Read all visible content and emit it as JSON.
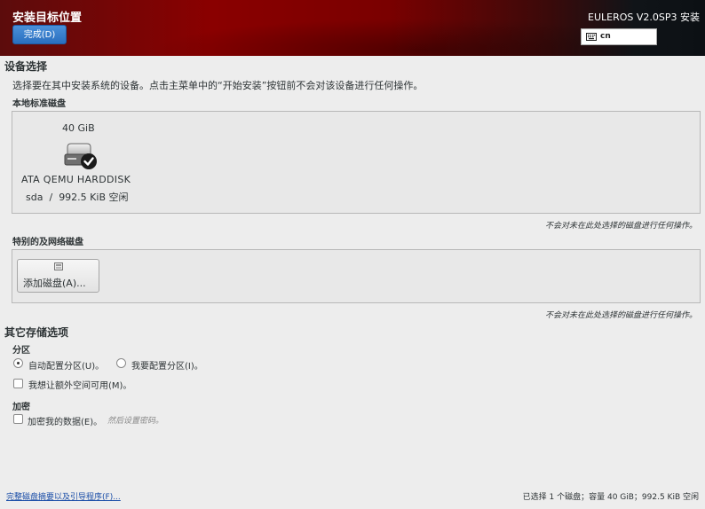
{
  "header": {
    "title": "安装目标位置",
    "done_button": "完成(D)",
    "product": "EULEROS V2.0SP3 安装",
    "keyboard_layout": "cn",
    "keyboard_icon": "keyboard-icon"
  },
  "device_selection": {
    "title": "设备选择",
    "description": "选择要在其中安装系统的设备。点击主菜单中的“开始安装”按钮前不会对该设备进行任何操作。",
    "local_disks": {
      "title": "本地标准磁盘",
      "disks": [
        {
          "size": "40 GiB",
          "name": "ATA QEMU HARDDISK",
          "device": "sda",
          "separator": "/",
          "free": "992.5 KiB 空闲",
          "selected": true,
          "icon": "harddisk-selected-icon"
        }
      ],
      "note": "不会对未在此处选择的磁盘进行任何操作。"
    },
    "special_disks": {
      "title": "特别的及网络磁盘",
      "add_button": "添加磁盘(A)...",
      "add_icon": "network-disk-icon",
      "note": "不会对未在此处选择的磁盘进行任何操作。"
    }
  },
  "other_storage": {
    "title": "其它存储选项",
    "partition": {
      "title": "分区",
      "options": [
        {
          "label": "自动配置分区(U)。",
          "selected": true
        },
        {
          "label": "我要配置分区(I)。",
          "selected": false
        }
      ],
      "extra_space": {
        "label": "我想让额外空间可用(M)。",
        "checked": false
      }
    },
    "encryption": {
      "title": "加密",
      "encrypt": {
        "label": "加密我的数据(E)。",
        "checked": false
      },
      "hint": "然后设置密码。"
    }
  },
  "footer": {
    "summary_link": "完整磁盘摘要以及引导程序(F)...",
    "status": "已选择 1 个磁盘；容量 40 GiB；992.5 KiB 空闲"
  }
}
